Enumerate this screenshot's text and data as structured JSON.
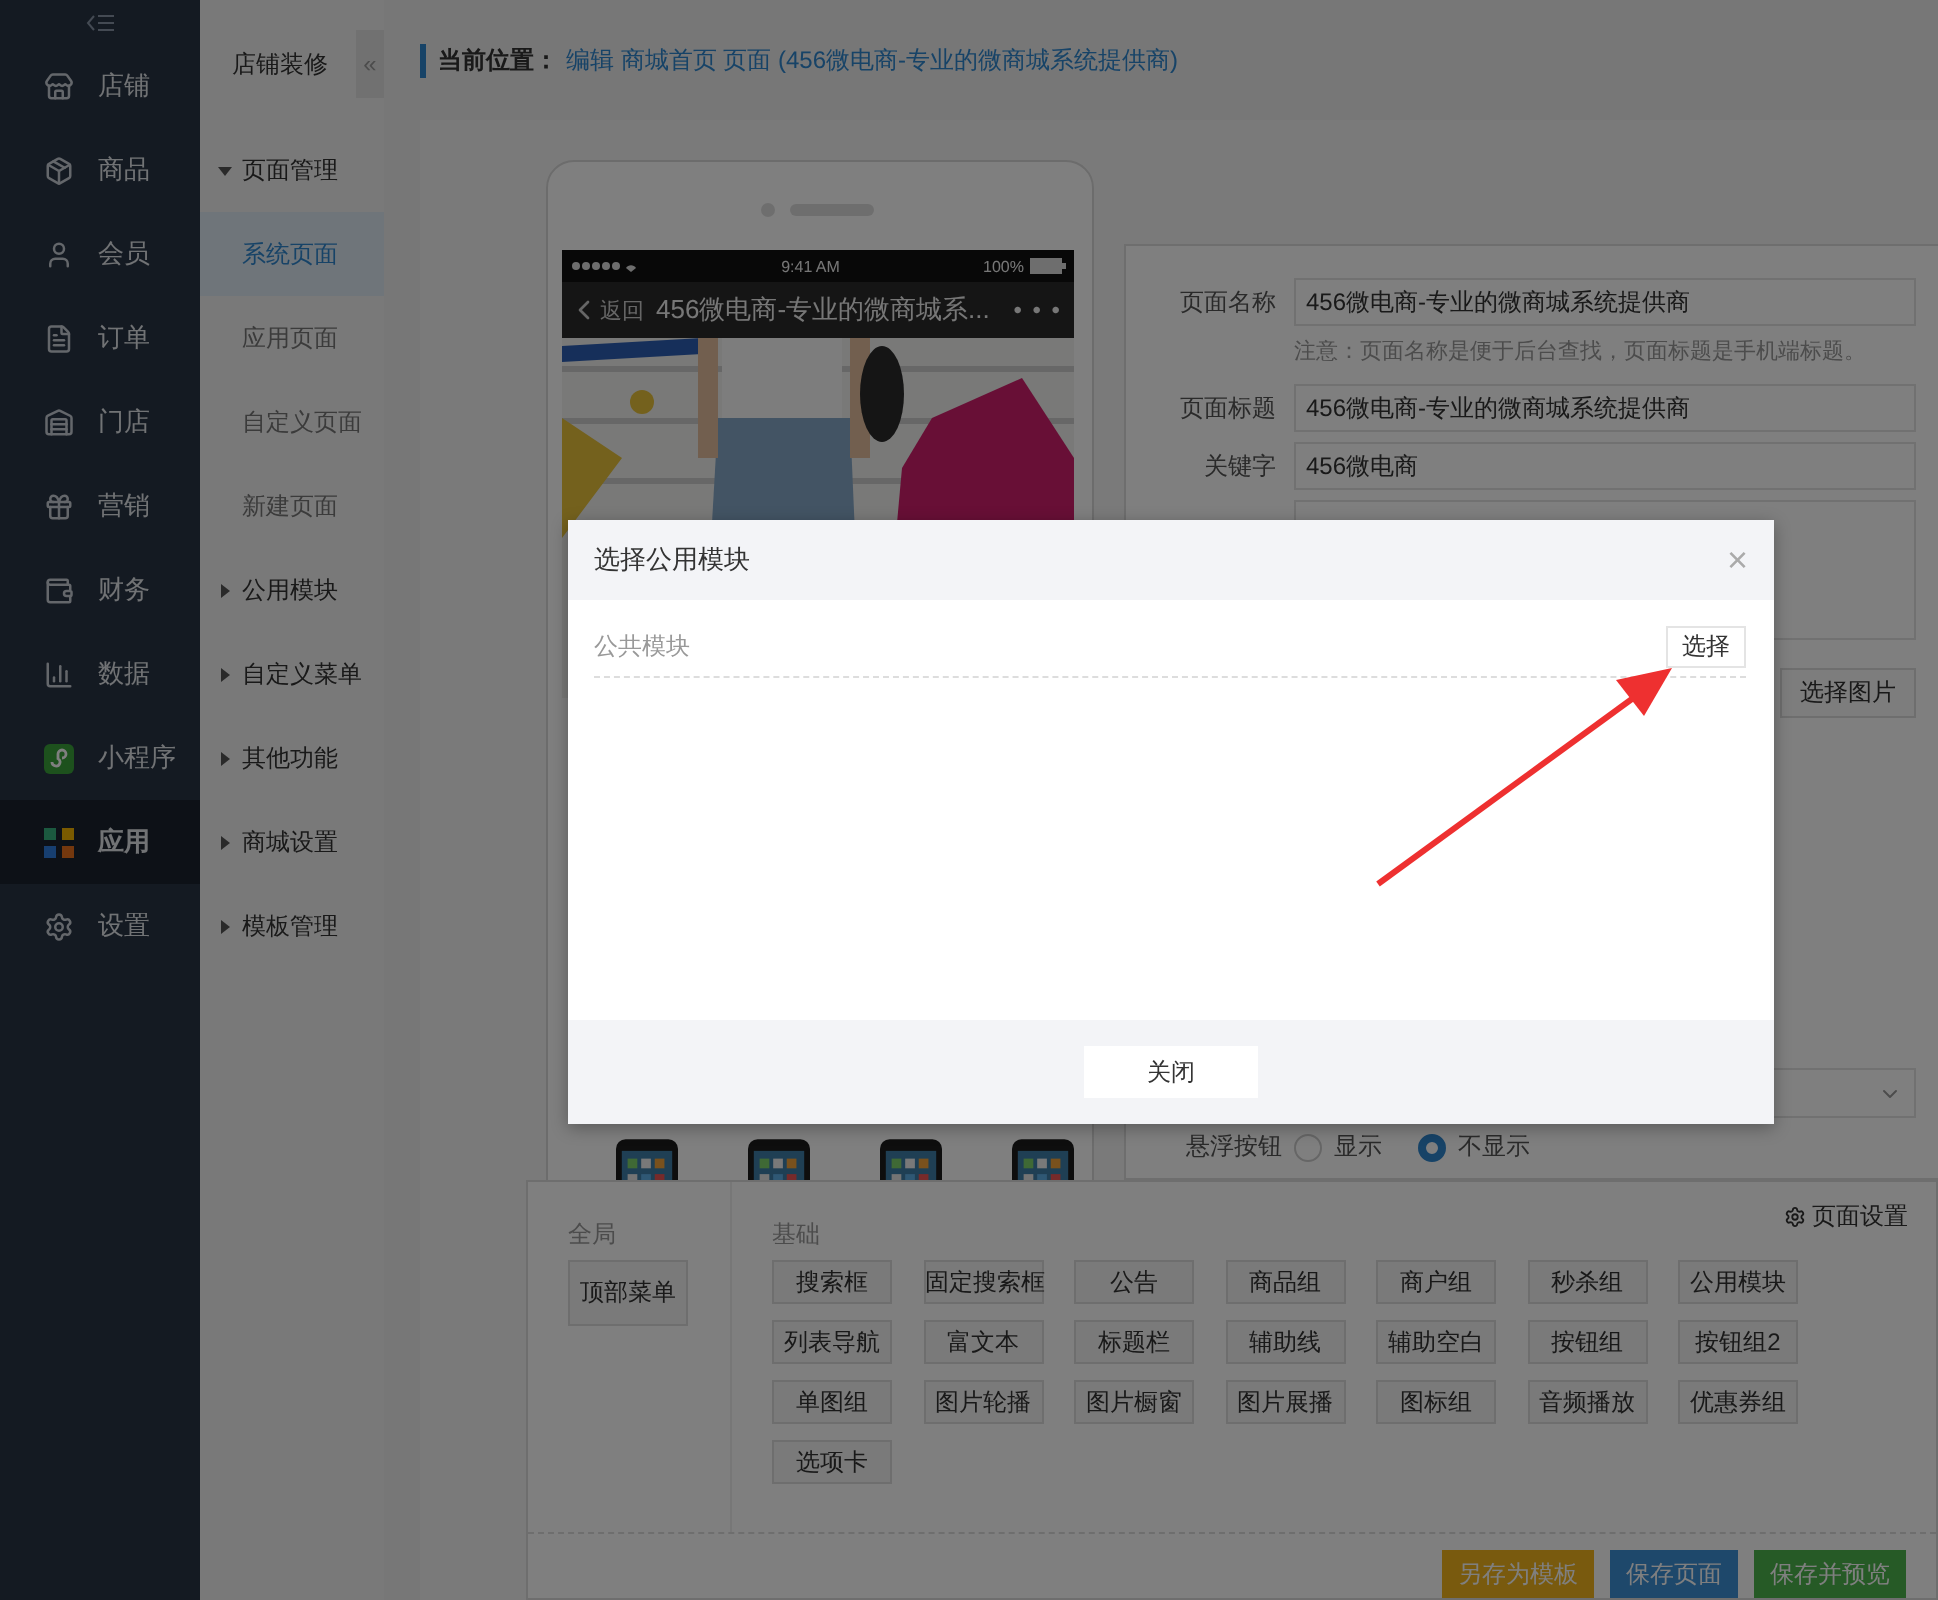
{
  "nav": {
    "items": [
      {
        "label": "店铺",
        "selected": false
      },
      {
        "label": "商品",
        "selected": false
      },
      {
        "label": "会员",
        "selected": false
      },
      {
        "label": "订单",
        "selected": false
      },
      {
        "label": "门店",
        "selected": false
      },
      {
        "label": "营销",
        "selected": false
      },
      {
        "label": "财务",
        "selected": false
      },
      {
        "label": "数据",
        "selected": false
      },
      {
        "label": "小程序",
        "selected": false
      },
      {
        "label": "应用",
        "selected": true
      },
      {
        "label": "设置",
        "selected": false
      }
    ]
  },
  "subnav": {
    "title": "店铺装修",
    "collapse": "«",
    "items": [
      {
        "label": "页面管理",
        "expanded": true,
        "children": [
          {
            "label": "系统页面",
            "selected": true
          },
          {
            "label": "应用页面",
            "selected": false
          },
          {
            "label": "自定义页面",
            "selected": false
          },
          {
            "label": "新建页面",
            "selected": false
          }
        ]
      },
      {
        "label": "公用模块",
        "expanded": false
      },
      {
        "label": "自定义菜单",
        "expanded": false
      },
      {
        "label": "其他功能",
        "expanded": false
      },
      {
        "label": "商城设置",
        "expanded": false
      },
      {
        "label": "模板管理",
        "expanded": false
      }
    ]
  },
  "breadcrumb": {
    "label": "当前位置：",
    "path": "编辑 商城首页 页面 (456微电商-专业的微商城系统提供商)"
  },
  "phone": {
    "time": "9:41 AM",
    "battery": "100%",
    "back": "返回",
    "title": "456微电商-专业的微商城系...",
    "more": "• • •"
  },
  "form": {
    "fields": [
      {
        "label": "页面名称",
        "value": "456微电商-专业的微商城系统提供商",
        "note": "注意：页面名称是便于后台查找，页面标题是手机端标题。"
      },
      {
        "label": "页面标题",
        "value": "456微电商-专业的微商城系统提供商"
      },
      {
        "label": "关键字",
        "value": "456微电商"
      }
    ],
    "image_button": "选择图片",
    "float_button": {
      "label": "悬浮按钮",
      "options": [
        {
          "label": "显示",
          "selected": false
        },
        {
          "label": "不显示",
          "selected": true
        }
      ]
    }
  },
  "components": {
    "settings": "页面设置",
    "global": {
      "label": "全局",
      "items": [
        "顶部菜单"
      ]
    },
    "basic": {
      "label": "基础",
      "items": [
        "搜索框",
        "固定搜索框",
        "公告",
        "商品组",
        "商户组",
        "秒杀组",
        "公用模块",
        "列表导航",
        "富文本",
        "标题栏",
        "辅助线",
        "辅助空白",
        "按钮组",
        "按钮组2",
        "单图组",
        "图片轮播",
        "图片橱窗",
        "图片展播",
        "图标组",
        "音频播放",
        "优惠券组",
        "选项卡"
      ]
    }
  },
  "actions": [
    {
      "label": "另存为模板",
      "kind": "template"
    },
    {
      "label": "保存页面",
      "kind": "save"
    },
    {
      "label": "保存并预览",
      "kind": "preview"
    }
  ],
  "dialog": {
    "title": "选择公用模块",
    "close": "×",
    "section": "公共模块",
    "select": "选择",
    "footer_button": "关闭"
  }
}
